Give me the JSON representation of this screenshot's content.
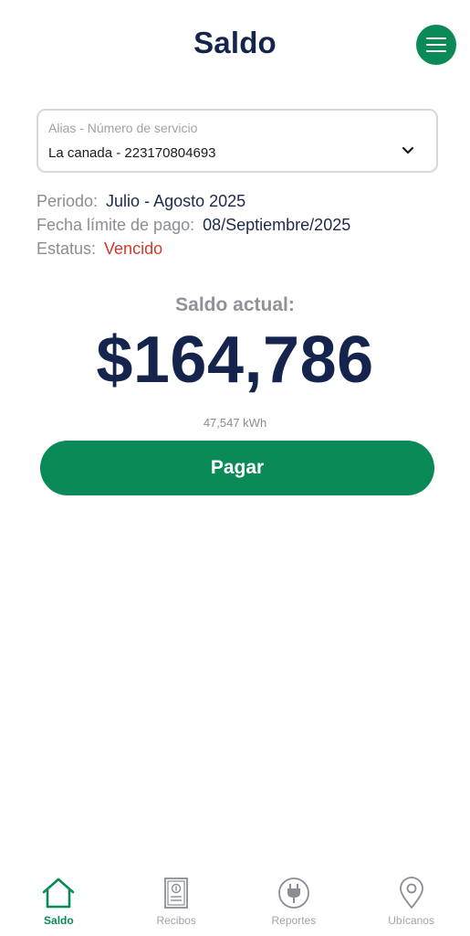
{
  "header": {
    "title": "Saldo",
    "menu_icon": "hamburger-menu-icon"
  },
  "service_selector": {
    "label": "Alias - Número de servicio",
    "value": "La canada - 223170804693"
  },
  "info": {
    "period_label": "Periodo:",
    "period_value": "Julio - Agosto 2025",
    "due_date_label": "Fecha límite de pago:",
    "due_date_value": "08/Septiembre/2025",
    "status_label": "Estatus:",
    "status_value": "Vencido"
  },
  "balance": {
    "label": "Saldo actual:",
    "amount": "$164,786",
    "consumption": "47,547 kWh"
  },
  "pay_button": {
    "label": "Pagar"
  },
  "tabs": [
    {
      "label": "Saldo",
      "icon": "home-icon",
      "active": true
    },
    {
      "label": "Recibos",
      "icon": "receipt-icon",
      "active": false
    },
    {
      "label": "Reportes",
      "icon": "plug-icon",
      "active": false
    },
    {
      "label": "Ubícanos",
      "icon": "location-pin-icon",
      "active": false
    }
  ],
  "colors": {
    "brand_green": "#0a8a57",
    "navy_text": "#14244c",
    "overdue_red": "#d23a2a"
  }
}
